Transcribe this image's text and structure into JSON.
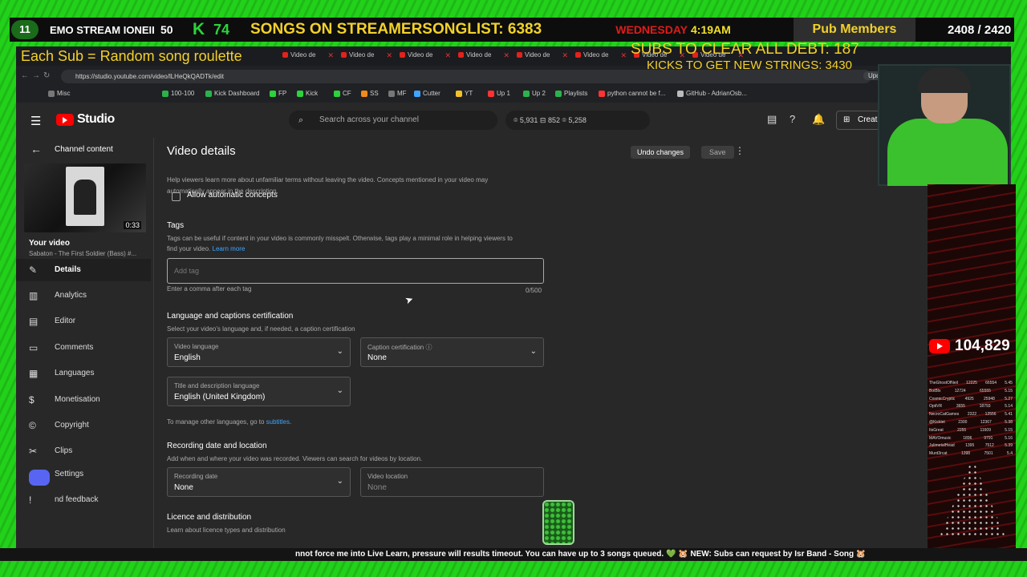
{
  "overlay": {
    "number_badge": "11",
    "stream_label": "EMO STREAM IONEII",
    "count_50": "50",
    "kick_letter": "K",
    "kick_count": "74",
    "songs_text": "SONGS ON STREAMERSONGLIST: 6383",
    "day": "WEDNESDAY",
    "time": "4:19AM",
    "pub_members": "Pub Members",
    "member_count": "2408 / 2420",
    "roulette": "Each Sub = Random song roulette",
    "subs_debt": "SUBS TO CLEAR ALL DEBT: 187",
    "kicks_strings": "KICKS TO GET NEW STRINGS: 3430",
    "views": "104,829",
    "ticker": "nnot force me into Live Learn, pressure will results timeout. You can have up to 3 songs queued. 💚 🐹 NEW: Subs can request by Isr Band - Song 🐹",
    "leaderboard": [
      {
        "name": "TheGhostOfNeil",
        "a": "12225",
        "b": "66554",
        "c": "5.45"
      },
      {
        "name": "BotBlx",
        "a": "12724",
        "b": "65555",
        "c": "5.15"
      },
      {
        "name": "CosmicCryptic",
        "a": "4925",
        "b": "25948",
        "c": "5.27"
      },
      {
        "name": "OptiVR",
        "a": "3655",
        "b": "18793",
        "c": "5.14"
      },
      {
        "name": "NecroCatGames",
        "a": "2322",
        "b": "12556",
        "c": "5.41"
      },
      {
        "name": "@Kicklet",
        "a": "2300",
        "b": "12367",
        "c": "5.38"
      },
      {
        "name": "ItsGreat",
        "a": "2255",
        "b": "11609",
        "c": "5.15"
      },
      {
        "name": "MAVOmusic",
        "a": "1896",
        "b": "9791",
        "c": "5.16"
      },
      {
        "name": "JulimetalHead",
        "a": "1395",
        "b": "7512",
        "c": "5.39"
      },
      {
        "name": "Murd3rcat",
        "a": "1398",
        "b": "7501",
        "c": "5.4"
      }
    ]
  },
  "browser": {
    "tab_label": "Video de",
    "tab_count": 8,
    "url": "https://studio.youtube.com/video/lLHeQkQADTk/edit",
    "update_label": "Update",
    "bookmarks": [
      "Misc",
      "100-100",
      "Kick Dashboard",
      "FP",
      "Kick",
      "CF",
      "SS",
      "MF",
      "Cutter",
      "YT",
      "Up 1",
      "Up 2",
      "Playlists",
      "python cannot be f...",
      "GitHub - AdrianOsb..."
    ]
  },
  "header": {
    "logo_text": "Studio",
    "search_placeholder": "Search across your channel",
    "stats": "⌾ 5,931   ⊟ 852   ⌾ 5,258",
    "create_label": "Create"
  },
  "sidebar": {
    "back_label": "Channel content",
    "thumb_duration": "0:33",
    "your_video": "Your video",
    "video_title": "Sabaton - The First Soldier (Bass) #...",
    "items": [
      {
        "label": "Details",
        "icon": "✎"
      },
      {
        "label": "Analytics",
        "icon": "▥"
      },
      {
        "label": "Editor",
        "icon": "▤"
      },
      {
        "label": "Comments",
        "icon": "▭"
      },
      {
        "label": "Languages",
        "icon": "▦"
      },
      {
        "label": "Monetisation",
        "icon": "$"
      },
      {
        "label": "Copyright",
        "icon": "©"
      },
      {
        "label": "Clips",
        "icon": "✂"
      },
      {
        "label": "Settings",
        "icon": "⚙"
      },
      {
        "label": "nd feedback",
        "icon": "!"
      }
    ]
  },
  "main": {
    "page_title": "Video details",
    "undo_label": "Undo changes",
    "save_label": "Save",
    "concepts_help_1": "Help viewers learn more about unfamiliar terms without leaving the video. Concepts mentioned in your video may",
    "concepts_help_2": "automatically appear in the description.",
    "allow_concepts": "Allow automatic concepts",
    "tags_title": "Tags",
    "tags_help_1": "Tags can be useful if content in your video is commonly misspelt. Otherwise, tags play a minimal role in helping viewers to",
    "tags_help_2": "find your video.",
    "learn_more": "Learn more",
    "tag_placeholder": "Add tag",
    "tag_hint": "Enter a comma after each tag",
    "tag_counter": "0/500",
    "lang_title": "Language and captions certification",
    "lang_help": "Select your video's language and, if needed, a caption certification",
    "video_language_label": "Video language",
    "video_language_value": "English",
    "caption_cert_label": "Caption certification  ⓘ",
    "caption_cert_value": "None",
    "title_lang_label": "Title and description language",
    "title_lang_value": "English (United Kingdom)",
    "manage_lang": "To manage other languages, go to",
    "subtitles_link": "subtitles",
    "recording_title": "Recording date and location",
    "recording_help": "Add when and where your video was recorded. Viewers can search for videos by location.",
    "recording_date_label": "Recording date",
    "recording_date_value": "None",
    "video_location_label": "Video location",
    "video_location_value": "None",
    "licence_title": "Licence and distribution",
    "licence_help": "Learn about licence types and distribution"
  },
  "colors": {
    "accent_red": "#ff0000",
    "link_blue": "#3ea6ff",
    "overlay_green": "#22d11a",
    "overlay_yellow": "#f2d12a"
  }
}
